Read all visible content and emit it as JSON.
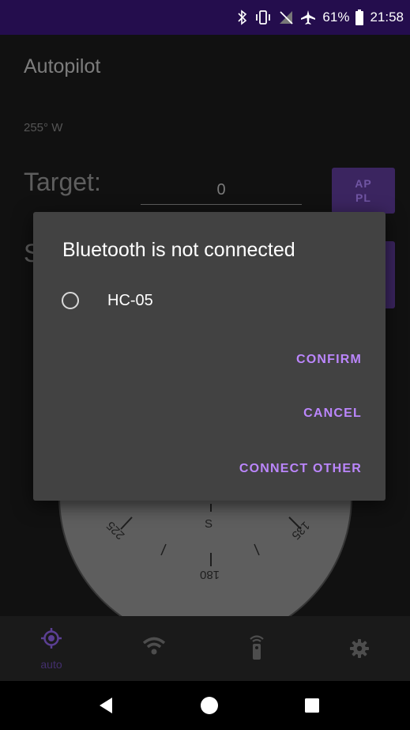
{
  "status_bar": {
    "battery_percent": "61%",
    "time": "21:58"
  },
  "app": {
    "title": "Autopilot",
    "heading": "255° W",
    "target_label": "Target:",
    "target_value": "0",
    "ap_button_line1": "AP",
    "ap_button_line2": "PL",
    "second_label_visible": "S"
  },
  "compass": {
    "marks": [
      "225",
      "S",
      "135",
      "180"
    ]
  },
  "dialog": {
    "title": "Bluetooth is not connected",
    "options": [
      {
        "label": "HC-05",
        "selected": false
      }
    ],
    "confirm_label": "CONFIRM",
    "cancel_label": "CANCEL",
    "connect_other_label": "CONNECT OTHER"
  },
  "bottom_nav": {
    "items": [
      {
        "label": "auto",
        "icon": "gps-target-icon",
        "active": true
      },
      {
        "label": "",
        "icon": "wifi-icon",
        "active": false
      },
      {
        "label": "",
        "icon": "remote-control-icon",
        "active": false
      },
      {
        "label": "",
        "icon": "gear-icon",
        "active": false
      }
    ]
  },
  "colors": {
    "accent": "#bb86fc",
    "status_bar": "#240d4d",
    "dialog_bg": "#424242"
  }
}
